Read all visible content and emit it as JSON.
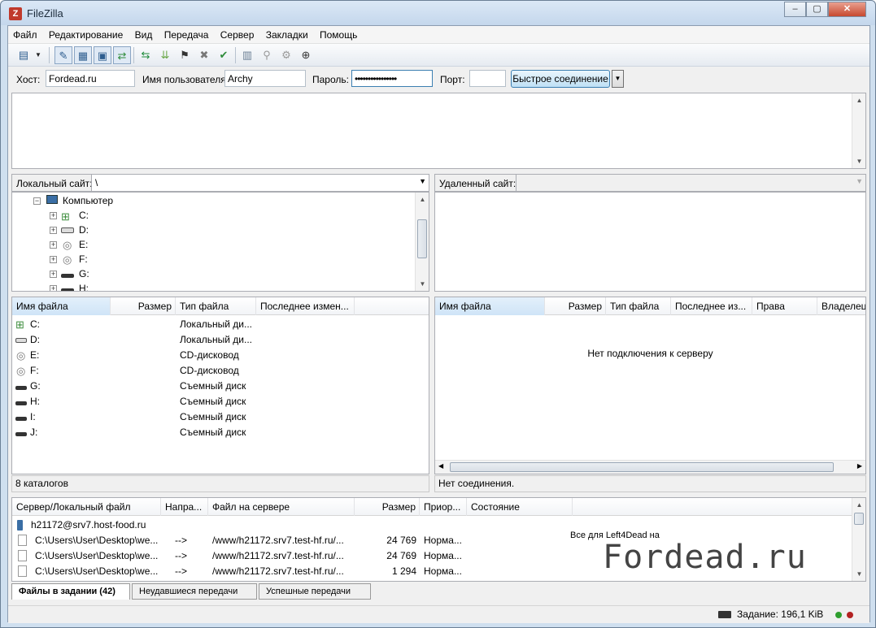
{
  "window": {
    "title": "FileZilla",
    "minimize": "–",
    "maximize": "▢",
    "close": "✕"
  },
  "menu": [
    "Файл",
    "Редактирование",
    "Вид",
    "Передача",
    "Сервер",
    "Закладки",
    "Помощь"
  ],
  "quickconnect": {
    "host_label": "Хост:",
    "host_value": "Fordead.ru",
    "user_label": "Имя пользователя",
    "user_value": "Archy",
    "pass_label": "Пароль:",
    "pass_value": "••••••••••••••••",
    "port_label": "Порт:",
    "port_value": "",
    "connect_button": "Быстрое соединение"
  },
  "local": {
    "site_label": "Локальный сайт:",
    "path": "\\",
    "tree_root": "Компьютер",
    "tree": [
      "C:",
      "D:",
      "E:",
      "F:",
      "G:",
      "H:"
    ],
    "columns": [
      "Имя файла",
      "Размер",
      "Тип файла",
      "Последнее измен..."
    ],
    "files": [
      {
        "name": "C:",
        "type": "Локальный ди...",
        "icon": "win-drive-icon"
      },
      {
        "name": "D:",
        "type": "Локальный ди...",
        "icon": "hdd-icon"
      },
      {
        "name": "E:",
        "type": "CD-дисковод",
        "icon": "cd-icon"
      },
      {
        "name": "F:",
        "type": "CD-дисковод",
        "icon": "cd-icon"
      },
      {
        "name": "G:",
        "type": "Съемный диск",
        "icon": "removable-icon"
      },
      {
        "name": "H:",
        "type": "Съемный диск",
        "icon": "removable-icon"
      },
      {
        "name": "I:",
        "type": "Съемный диск",
        "icon": "removable-icon"
      },
      {
        "name": "J:",
        "type": "Съемный диск",
        "icon": "removable-icon"
      }
    ],
    "status": "8 каталогов"
  },
  "remote": {
    "site_label": "Удаленный сайт:",
    "path": "",
    "columns": [
      "Имя файла",
      "Размер",
      "Тип файла",
      "Последнее из...",
      "Права",
      "Владелец"
    ],
    "empty_message": "Нет подключения к серверу",
    "status": "Нет соединения."
  },
  "queue": {
    "columns": [
      "Сервер/Локальный файл",
      "Напра...",
      "Файл на сервере",
      "Размер",
      "Приор...",
      "Состояние"
    ],
    "server": "h21172@srv7.host-food.ru",
    "rows": [
      {
        "local": "C:\\Users\\User\\Desktop\\we...",
        "dir": "-->",
        "remote": "/www/h21172.srv7.test-hf.ru/...",
        "size": "24 769",
        "prio": "Норма..."
      },
      {
        "local": "C:\\Users\\User\\Desktop\\we...",
        "dir": "-->",
        "remote": "/www/h21172.srv7.test-hf.ru/...",
        "size": "24 769",
        "prio": "Норма..."
      },
      {
        "local": "C:\\Users\\User\\Desktop\\we...",
        "dir": "-->",
        "remote": "/www/h21172.srv7.test-hf.ru/...",
        "size": "1 294",
        "prio": "Норма..."
      }
    ],
    "watermark_small": "Все для Left4Dead на",
    "watermark_big": "Fordead.ru",
    "tabs": [
      "Файлы в задании (42)",
      "Неудавшиеся передачи",
      "Успешные передачи"
    ]
  },
  "statusbar": {
    "task": "Задание: 196,1 KiB",
    "indicator_green": "#2e9e2e",
    "indicator_red": "#b22222"
  }
}
